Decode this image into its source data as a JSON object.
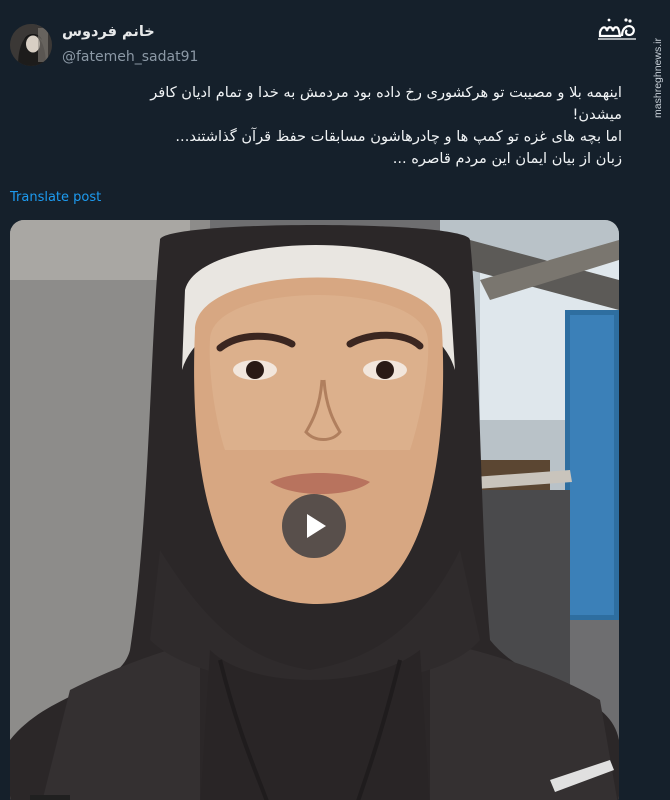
{
  "post": {
    "author": {
      "display_name": "خانم فردوس",
      "handle": "@fatemeh_sadat91"
    },
    "text_lines": [
      "اینهمه بلا و مصیبت تو هرکشوری رخ داده بود مردمش به خدا و تمام ادیان کافر",
      "میشدن!",
      "اما بچه های غزه تو کمپ ها و چادرهاشون مسابقات حفظ قرآن گذاشتند...",
      "زبان از بیان ایمان این مردم قاصره ..."
    ],
    "translate_label": "Translate post"
  },
  "brand": {
    "logo_text": "مشرق",
    "watermark": "mashreghnews.ir"
  },
  "media": {
    "type": "video",
    "play_icon": "play-icon"
  },
  "colors": {
    "background": "#15202b",
    "link": "#1d9bf0",
    "secondary_text": "#8b98a5"
  }
}
